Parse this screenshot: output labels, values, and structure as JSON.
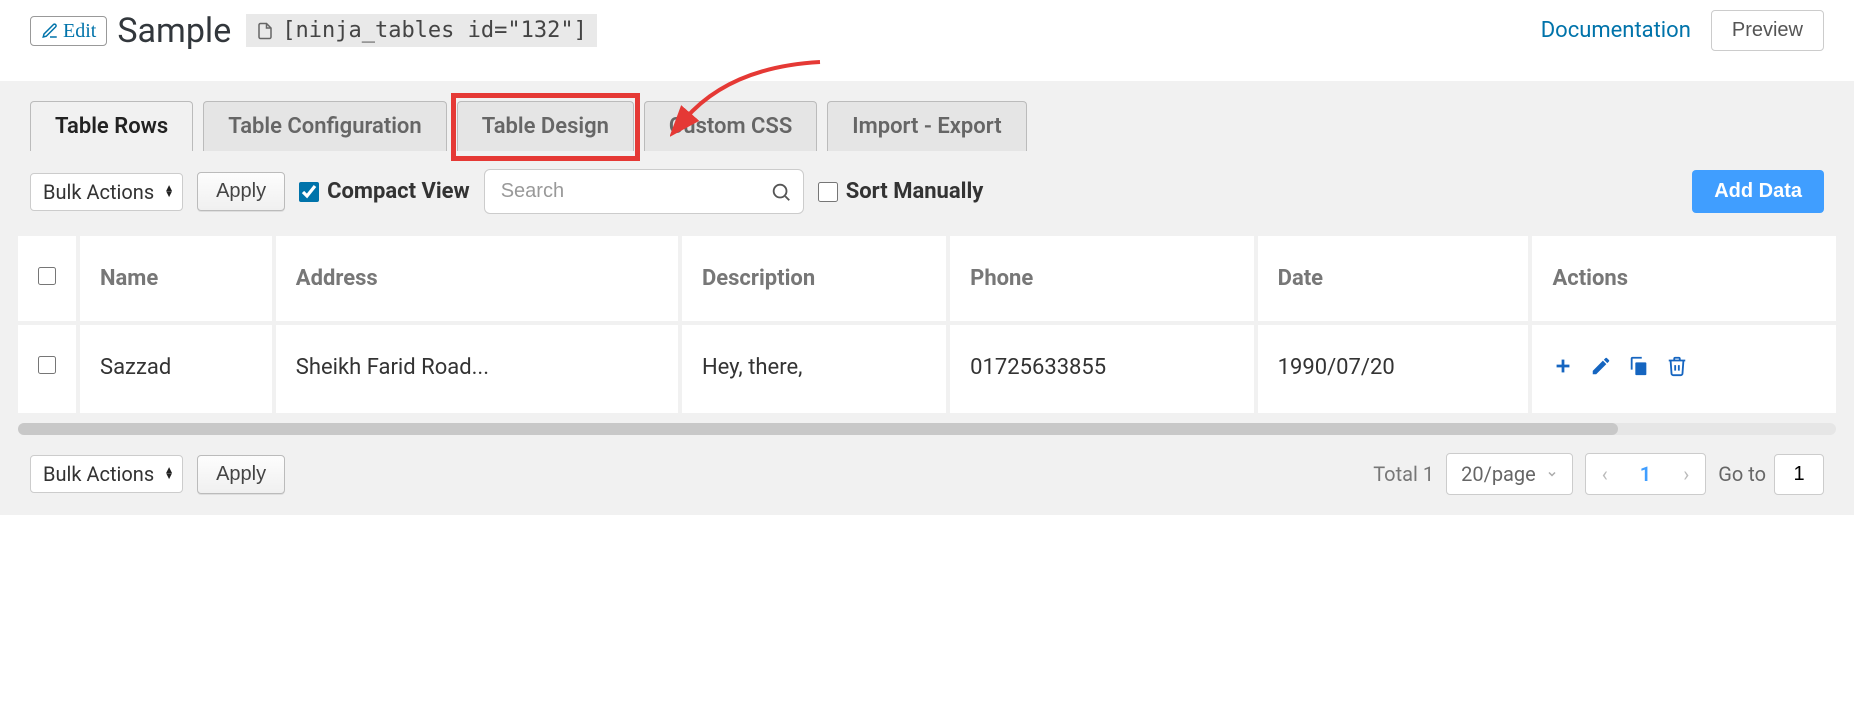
{
  "header": {
    "edit_label": "Edit",
    "title": "Sample",
    "shortcode": "[ninja_tables id=\"132\"]",
    "documentation": "Documentation",
    "preview": "Preview"
  },
  "tabs": [
    {
      "label": "Table Rows",
      "active": true
    },
    {
      "label": "Table Configuration",
      "active": false
    },
    {
      "label": "Table Design",
      "active": false,
      "highlighted": true
    },
    {
      "label": "Custom CSS",
      "active": false
    },
    {
      "label": "Import - Export",
      "active": false
    }
  ],
  "toolbar": {
    "bulk_actions": "Bulk Actions",
    "apply": "Apply",
    "compact_view": "Compact View",
    "compact_checked": true,
    "search_placeholder": "Search",
    "sort_manually": "Sort Manually",
    "sort_checked": false,
    "add_data": "Add Data"
  },
  "columns": [
    "",
    "Name",
    "Address",
    "Description",
    "Phone",
    "Date",
    "Actions"
  ],
  "rows": [
    {
      "name": "Sazzad",
      "address": "Sheikh Farid Road...",
      "description": "Hey,  there,",
      "phone": "01725633855",
      "date": "1990/07/20"
    }
  ],
  "footer": {
    "bulk_actions": "Bulk Actions",
    "apply": "Apply",
    "total_label": "Total",
    "total_count": "1",
    "page_size": "20/page",
    "current_page": "1",
    "goto_label": "Go to",
    "goto_value": "1"
  }
}
